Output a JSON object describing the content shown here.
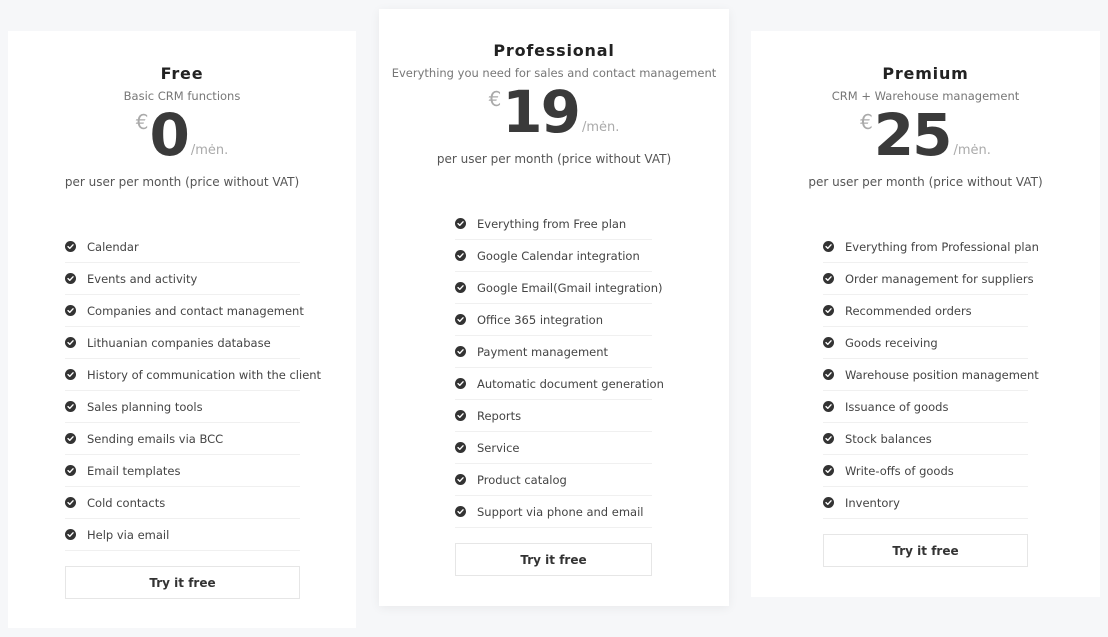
{
  "plans": [
    {
      "name": "Free",
      "subtitle": "Basic CRM functions",
      "currency": "€",
      "amount": "0",
      "period": "/mėn.",
      "price_note": "per user per month (price without VAT)",
      "features": [
        "Calendar",
        "Events and activity",
        "Companies and contact management",
        "Lithuanian companies database",
        "History of communication with the client",
        "Sales planning tools",
        "Sending emails via BCC",
        "Email templates",
        "Cold contacts",
        "Help via email"
      ],
      "cta": "Try it free"
    },
    {
      "name": "Professional",
      "subtitle": "Everything you need for sales and contact management",
      "currency": "€",
      "amount": "19",
      "period": "/mėn.",
      "price_note": "per user per month (price without VAT)",
      "features": [
        "Everything from Free plan",
        "Google Calendar integration",
        "Google Email(Gmail integration)",
        "Office 365 integration",
        "Payment management",
        "Automatic document generation",
        "Reports",
        "Service",
        "Product catalog",
        "Support via phone and email"
      ],
      "cta": "Try it free"
    },
    {
      "name": "Premium",
      "subtitle": "CRM + Warehouse management",
      "currency": "€",
      "amount": "25",
      "period": "/mėn.",
      "price_note": "per user per month (price without VAT)",
      "features": [
        "Everything from Professional plan",
        "Order management for suppliers",
        "Recommended orders",
        "Goods receiving",
        "Warehouse position management",
        "Issuance of goods",
        "Stock balances",
        "Write-offs of goods",
        "Inventory"
      ],
      "cta": "Try it free"
    }
  ],
  "icons": {
    "feature_bullet": "check-circle-icon"
  },
  "colors": {
    "background": "#f6f7f9",
    "card": "#ffffff",
    "accent_dark": "#333333",
    "muted": "#aaaaaa"
  }
}
